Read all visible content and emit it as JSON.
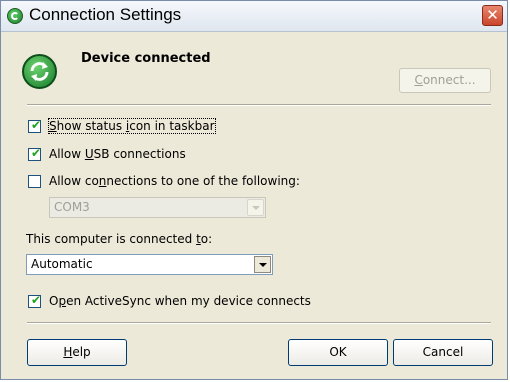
{
  "window": {
    "title": "Connection Settings",
    "close_glyph": "✕",
    "title_icon": "activesync-icon"
  },
  "device": {
    "status": "Device connected",
    "icon": "activesync-sync-icon",
    "connect_button": "Connect..."
  },
  "options": {
    "show_status_icon": {
      "label": "Show status icon in taskbar",
      "checked": true
    },
    "allow_usb": {
      "label": "Allow USB connections",
      "checked": true
    },
    "allow_connections": {
      "label": "Allow connections to one of the following:",
      "checked": false
    },
    "port_select": {
      "value": "COM3",
      "disabled": true
    },
    "connected_to_label": "This computer is connected to:",
    "connected_to_select": {
      "value": "Automatic"
    },
    "open_activesync": {
      "label": "Open ActiveSync when my device connects",
      "checked": true
    }
  },
  "buttons": {
    "help": "Help",
    "ok": "OK",
    "cancel": "Cancel"
  },
  "colors": {
    "check_mark": "#21a121",
    "close_button": "#c9452c",
    "dialog_bg": "#ece9d8"
  }
}
